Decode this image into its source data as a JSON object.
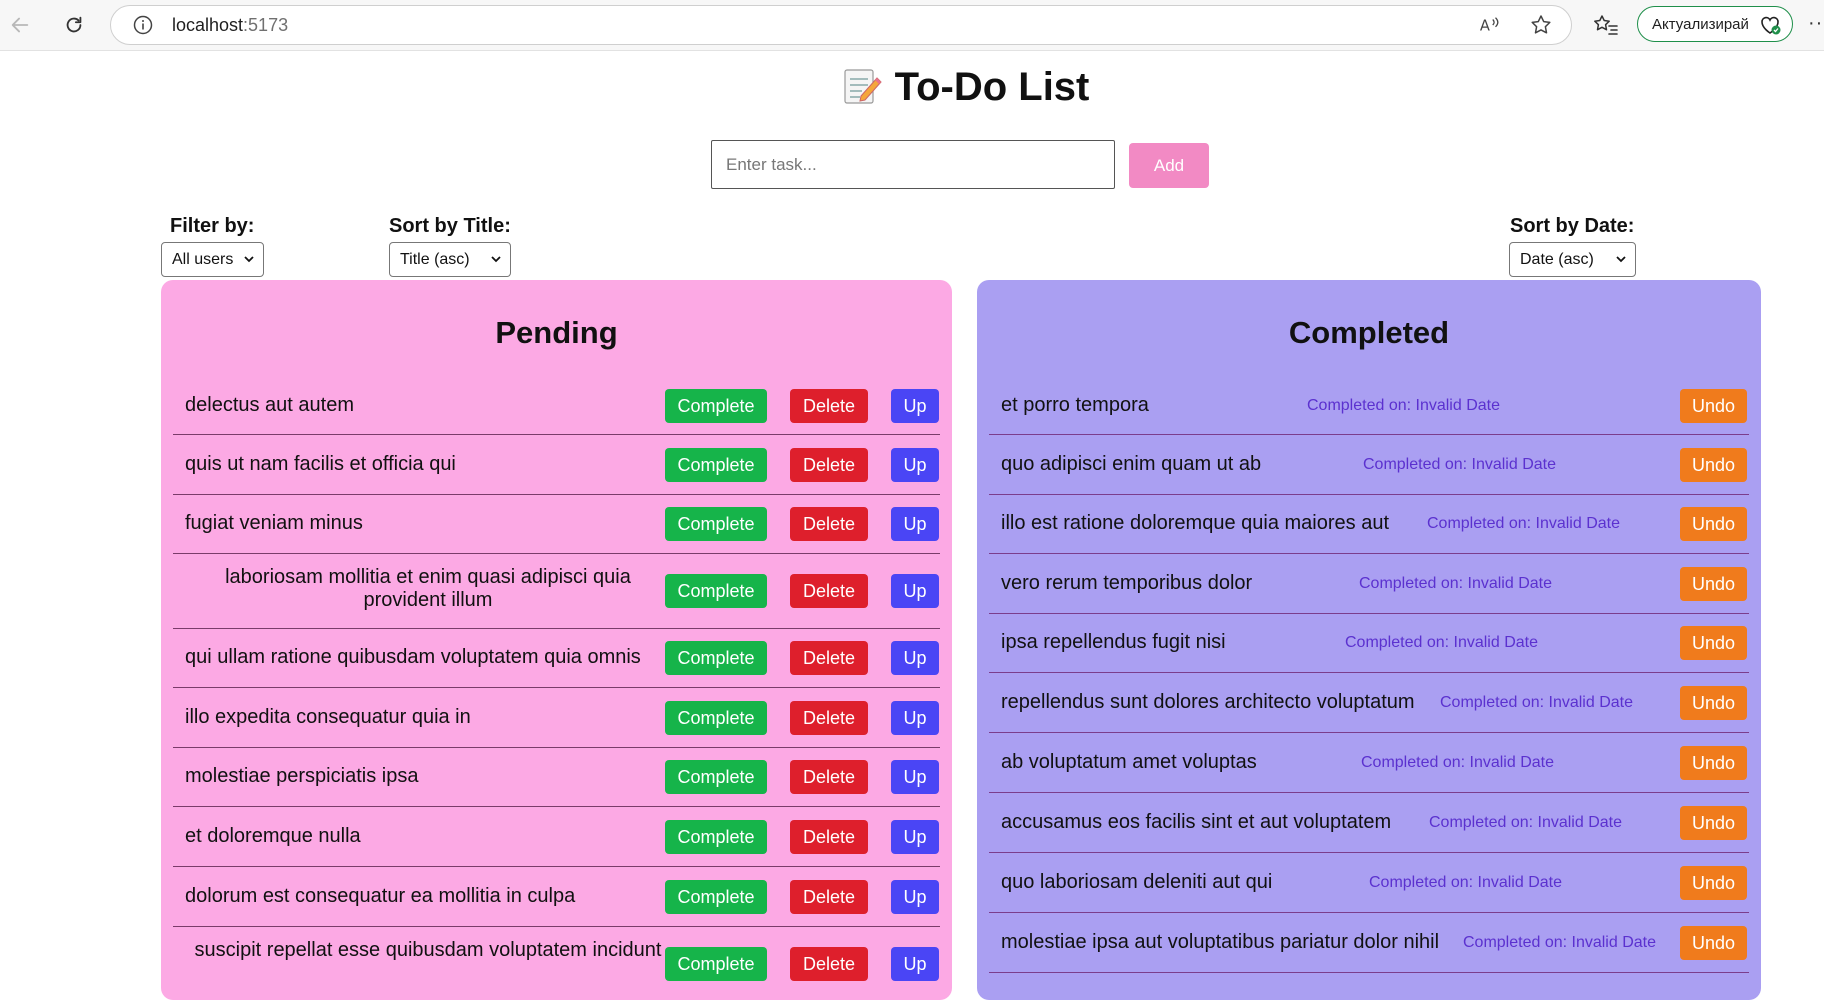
{
  "browser": {
    "url_host": "localhost",
    "url_port": ":5173",
    "update_label": "Актуализирай",
    "more_label": "···"
  },
  "app": {
    "title": "To-Do List",
    "input_placeholder": "Enter task...",
    "add_label": "Add"
  },
  "controls": {
    "filter_label": "Filter by:",
    "filter_value": "All users",
    "sort_title_label": "Sort by Title:",
    "sort_title_value": "Title (asc)",
    "sort_date_label": "Sort by Date:",
    "sort_date_value": "Date (asc)"
  },
  "pending": {
    "heading": "Pending",
    "complete_label": "Complete",
    "delete_label": "Delete",
    "up_label": "Up",
    "items": [
      "delectus aut autem",
      "quis ut nam facilis et officia qui",
      "fugiat veniam minus",
      "laboriosam mollitia et enim quasi adipisci quia provident illum",
      "qui ullam ratione quibusdam voluptatem quia omnis",
      "illo expedita consequatur quia in",
      "molestiae perspiciatis ipsa",
      "et doloremque nulla",
      "dolorum est consequatur ea mollitia in culpa",
      "suscipit repellat esse quibusdam voluptatem incidunt"
    ]
  },
  "completed": {
    "heading": "Completed",
    "undo_label": "Undo",
    "date_text": "Completed on: Invalid Date",
    "items": [
      "et porro tempora",
      "quo adipisci enim quam ut ab",
      "illo est ratione doloremque quia maiores aut",
      "vero rerum temporibus dolor",
      "ipsa repellendus fugit nisi",
      "repellendus sunt dolores architecto voluptatum",
      "ab voluptatum amet voluptas",
      "accusamus eos facilis sint et aut voluptatem",
      "quo laboriosam deleniti aut qui",
      "molestiae ipsa aut voluptatibus pariatur dolor nihil"
    ]
  }
}
